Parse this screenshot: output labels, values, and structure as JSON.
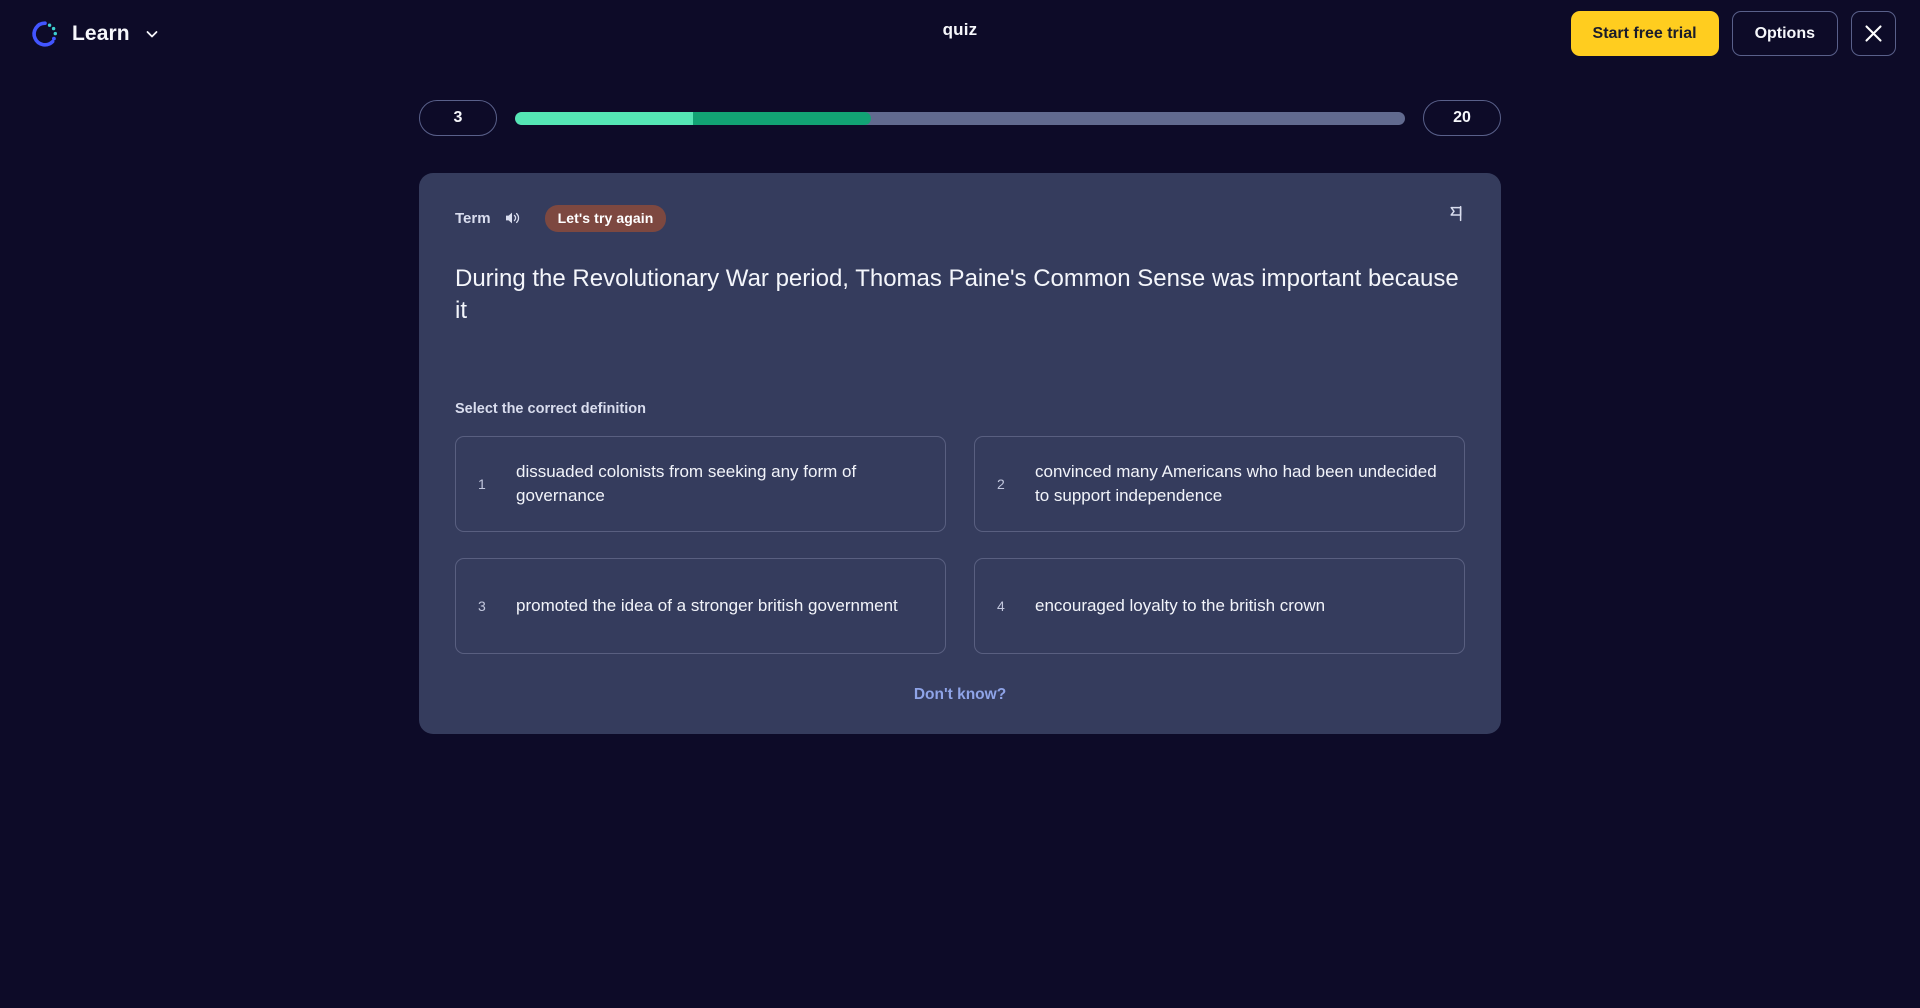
{
  "app": {
    "brand_name": "Learn",
    "logo_icon": "quizlet-logo-icon",
    "brand_chevron_icon": "chevron-down-icon",
    "window_title": "quiz"
  },
  "topbar": {
    "start_trial_label": "Start free trial",
    "options_label": "Options",
    "close_icon": "close-icon",
    "accent_yellow": "#ffcd1f",
    "border_color": "#59608a"
  },
  "progress": {
    "current": "3",
    "total": "20",
    "segment_light_percent": 20,
    "segment_dark_percent": 20,
    "segment_light_color": "#55e6b5",
    "segment_dark_color": "#12a374",
    "track_color": "#616a8f"
  },
  "card": {
    "header_label": "Term",
    "audio_icon": "speaker-icon",
    "flag_icon": "flag-icon",
    "status_badge": "Let's try again",
    "status_badge_color": "#7d4840",
    "prompt": "During the Revolutionary War period, Thomas Paine's Common Sense was important because it",
    "section_label": "Select the correct definition",
    "options": [
      {
        "number": "1",
        "text": "dissuaded colonists from seeking any form of governance"
      },
      {
        "number": "2",
        "text": "convinced many Americans who had been undecided to support independence"
      },
      {
        "number": "3",
        "text": "promoted the idea of a stronger british government"
      },
      {
        "number": "4",
        "text": "encouraged loyalty to the british crown"
      }
    ],
    "dont_know_label": "Don't know?"
  }
}
